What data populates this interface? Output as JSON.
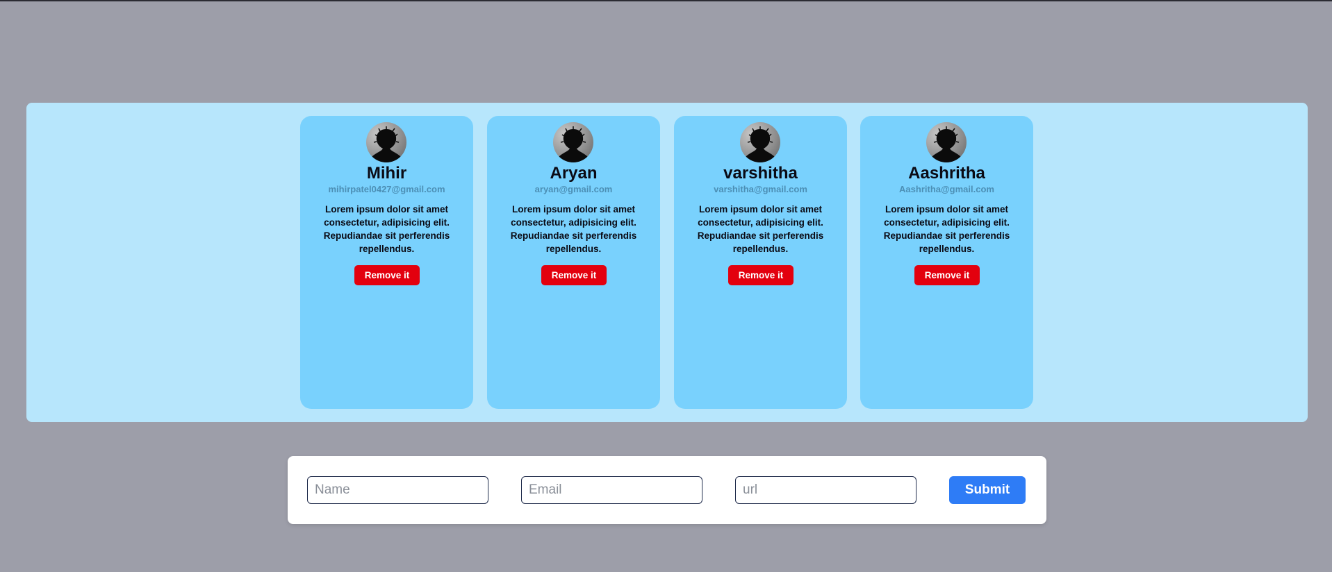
{
  "cards": [
    {
      "name": "Mihir",
      "email": "mihirpatel0427@gmail.com",
      "description": "Lorem ipsum dolor sit amet consectetur, adipisicing elit. Repudiandae sit perferendis repellendus.",
      "button_label": "Remove it",
      "avatar_icon": "profile-silhouette-icon"
    },
    {
      "name": "Aryan",
      "email": "aryan@gmail.com",
      "description": "Lorem ipsum dolor sit amet consectetur, adipisicing elit. Repudiandae sit perferendis repellendus.",
      "button_label": "Remove it",
      "avatar_icon": "profile-silhouette-icon"
    },
    {
      "name": "varshitha",
      "email": "varshitha@gmail.com",
      "description": "Lorem ipsum dolor sit amet consectetur, adipisicing elit. Repudiandae sit perferendis repellendus.",
      "button_label": "Remove it",
      "avatar_icon": "profile-silhouette-icon"
    },
    {
      "name": "Aashritha",
      "email": "Aashritha@gmail.com",
      "description": "Lorem ipsum dolor sit amet consectetur, adipisicing elit. Repudiandae sit perferendis repellendus.",
      "button_label": "Remove it",
      "avatar_icon": "profile-silhouette-icon"
    }
  ],
  "form": {
    "name_placeholder": "Name",
    "email_placeholder": "Email",
    "url_placeholder": "url",
    "name_value": "",
    "email_value": "",
    "url_value": "",
    "submit_label": "Submit"
  },
  "colors": {
    "page_background": "#9d9ea9",
    "panel_background": "#b7e6fc",
    "card_background": "#79d1fd",
    "remove_button": "#e3000e",
    "submit_button": "#2e7cf6"
  }
}
